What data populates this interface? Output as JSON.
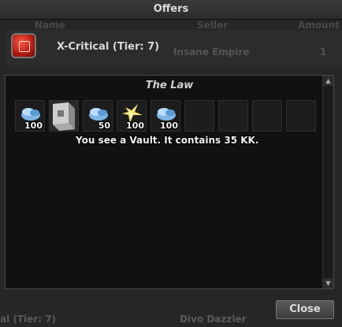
{
  "window": {
    "title": "Offers"
  },
  "columns": {
    "name": "Name",
    "seller": "Seller",
    "amount": "Amount"
  },
  "offer": {
    "name": "X-Critical (Tier: 7)",
    "seller": "Insane Empire",
    "amount": "1"
  },
  "bottom_row": {
    "name": "al (Tier: 7)",
    "seller": "Divo Dazzler"
  },
  "container": {
    "title": "The Law",
    "slots": [
      {
        "item": "crystal-coins-icon",
        "count": "100"
      },
      {
        "item": "vault-icon",
        "count": ""
      },
      {
        "item": "crystal-coins-icon",
        "count": "50"
      },
      {
        "item": "gold-star-item-icon",
        "count": "100"
      },
      {
        "item": "crystal-coins-icon",
        "count": "100"
      },
      {
        "item": "",
        "count": ""
      },
      {
        "item": "",
        "count": ""
      },
      {
        "item": "",
        "count": ""
      },
      {
        "item": "",
        "count": ""
      }
    ],
    "tooltip": "You see a Vault. It contains 35 KK."
  },
  "buttons": {
    "close": "Close"
  }
}
